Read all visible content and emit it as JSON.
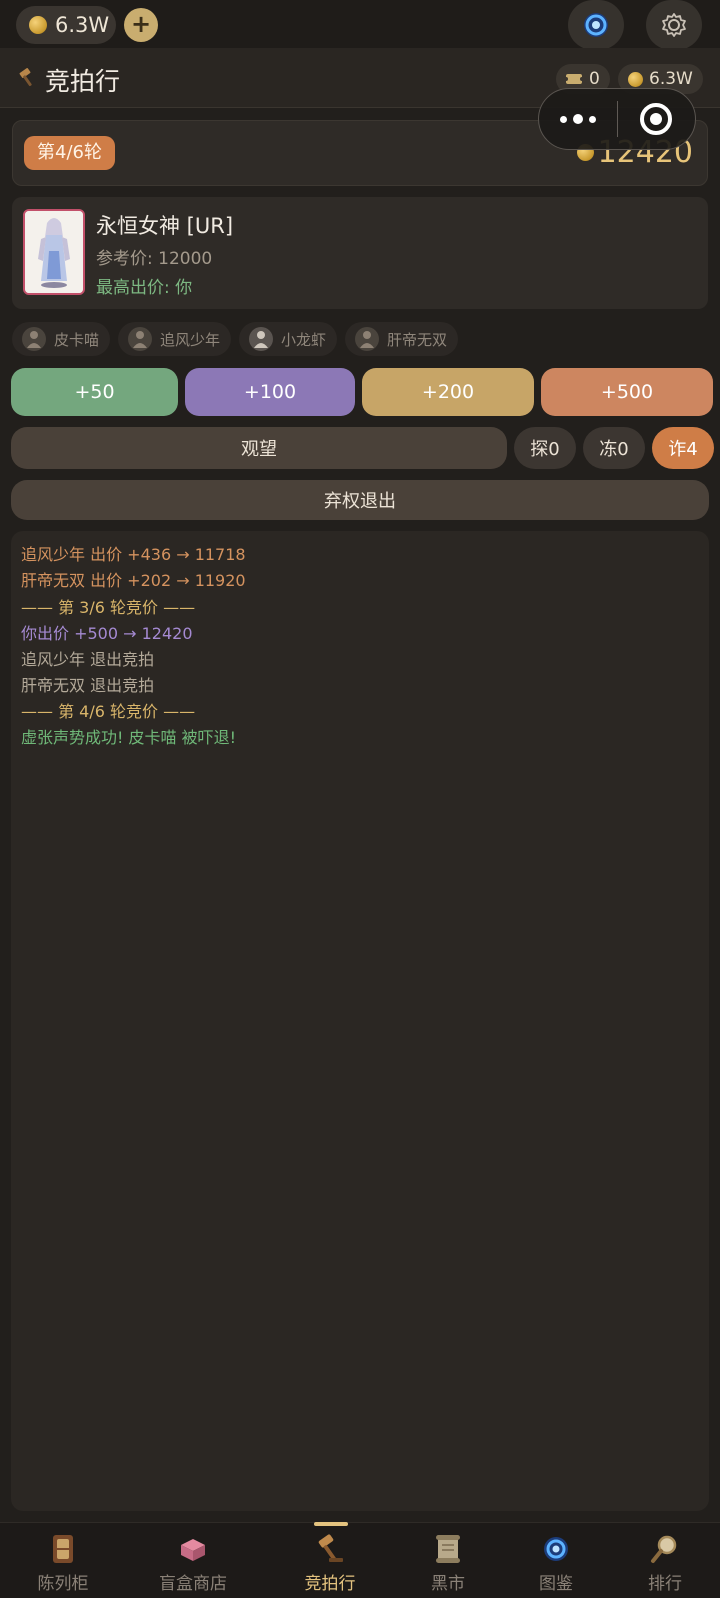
{
  "topbar": {
    "coins": "6.3W",
    "plus_label": "+"
  },
  "header": {
    "title": "竞拍行",
    "tickets": "0",
    "coins": "6.3W"
  },
  "round": {
    "badge": "第4/6轮",
    "current_price": "12420"
  },
  "item": {
    "name": "永恒女神 [UR]",
    "ref_price": "参考价: 12000",
    "top_bid": "最高出价: 你"
  },
  "players": [
    "皮卡喵",
    "追风少年",
    "小龙虾",
    "肝帝无双"
  ],
  "bids": [
    {
      "label": "+50",
      "color": "#74a77e"
    },
    {
      "label": "+100",
      "color": "#8c78b6"
    },
    {
      "label": "+200",
      "color": "#c7a567"
    },
    {
      "label": "+500",
      "color": "#cd8660"
    }
  ],
  "actions": {
    "watch": "观望",
    "probe": "探0",
    "freeze": "冻0",
    "bluff": "诈4",
    "quit": "弃权退出"
  },
  "log": [
    {
      "text": "追风少年 出价 +436 → 11718",
      "color": "#d5935f"
    },
    {
      "text": "肝帝无双 出价 +202 → 11920",
      "color": "#d5935f"
    },
    {
      "text": "—— 第 3/6 轮竞价 ——",
      "color": "#d9b56a"
    },
    {
      "text": "你出价 +500 → 12420",
      "color": "#a58ad2"
    },
    {
      "text": "追风少年 退出竞拍",
      "color": "#b3a999"
    },
    {
      "text": "肝帝无双 退出竞拍",
      "color": "#b3a999"
    },
    {
      "text": "—— 第 4/6 轮竞价 ——",
      "color": "#d9b56a"
    },
    {
      "text": "虚张声势成功! 皮卡喵 被吓退!",
      "color": "#6fb878"
    }
  ],
  "tabs": [
    "陈列柜",
    "盲盒商店",
    "竞拍行",
    "黑市",
    "图鉴",
    "排行"
  ],
  "active_tab": "竞拍行"
}
